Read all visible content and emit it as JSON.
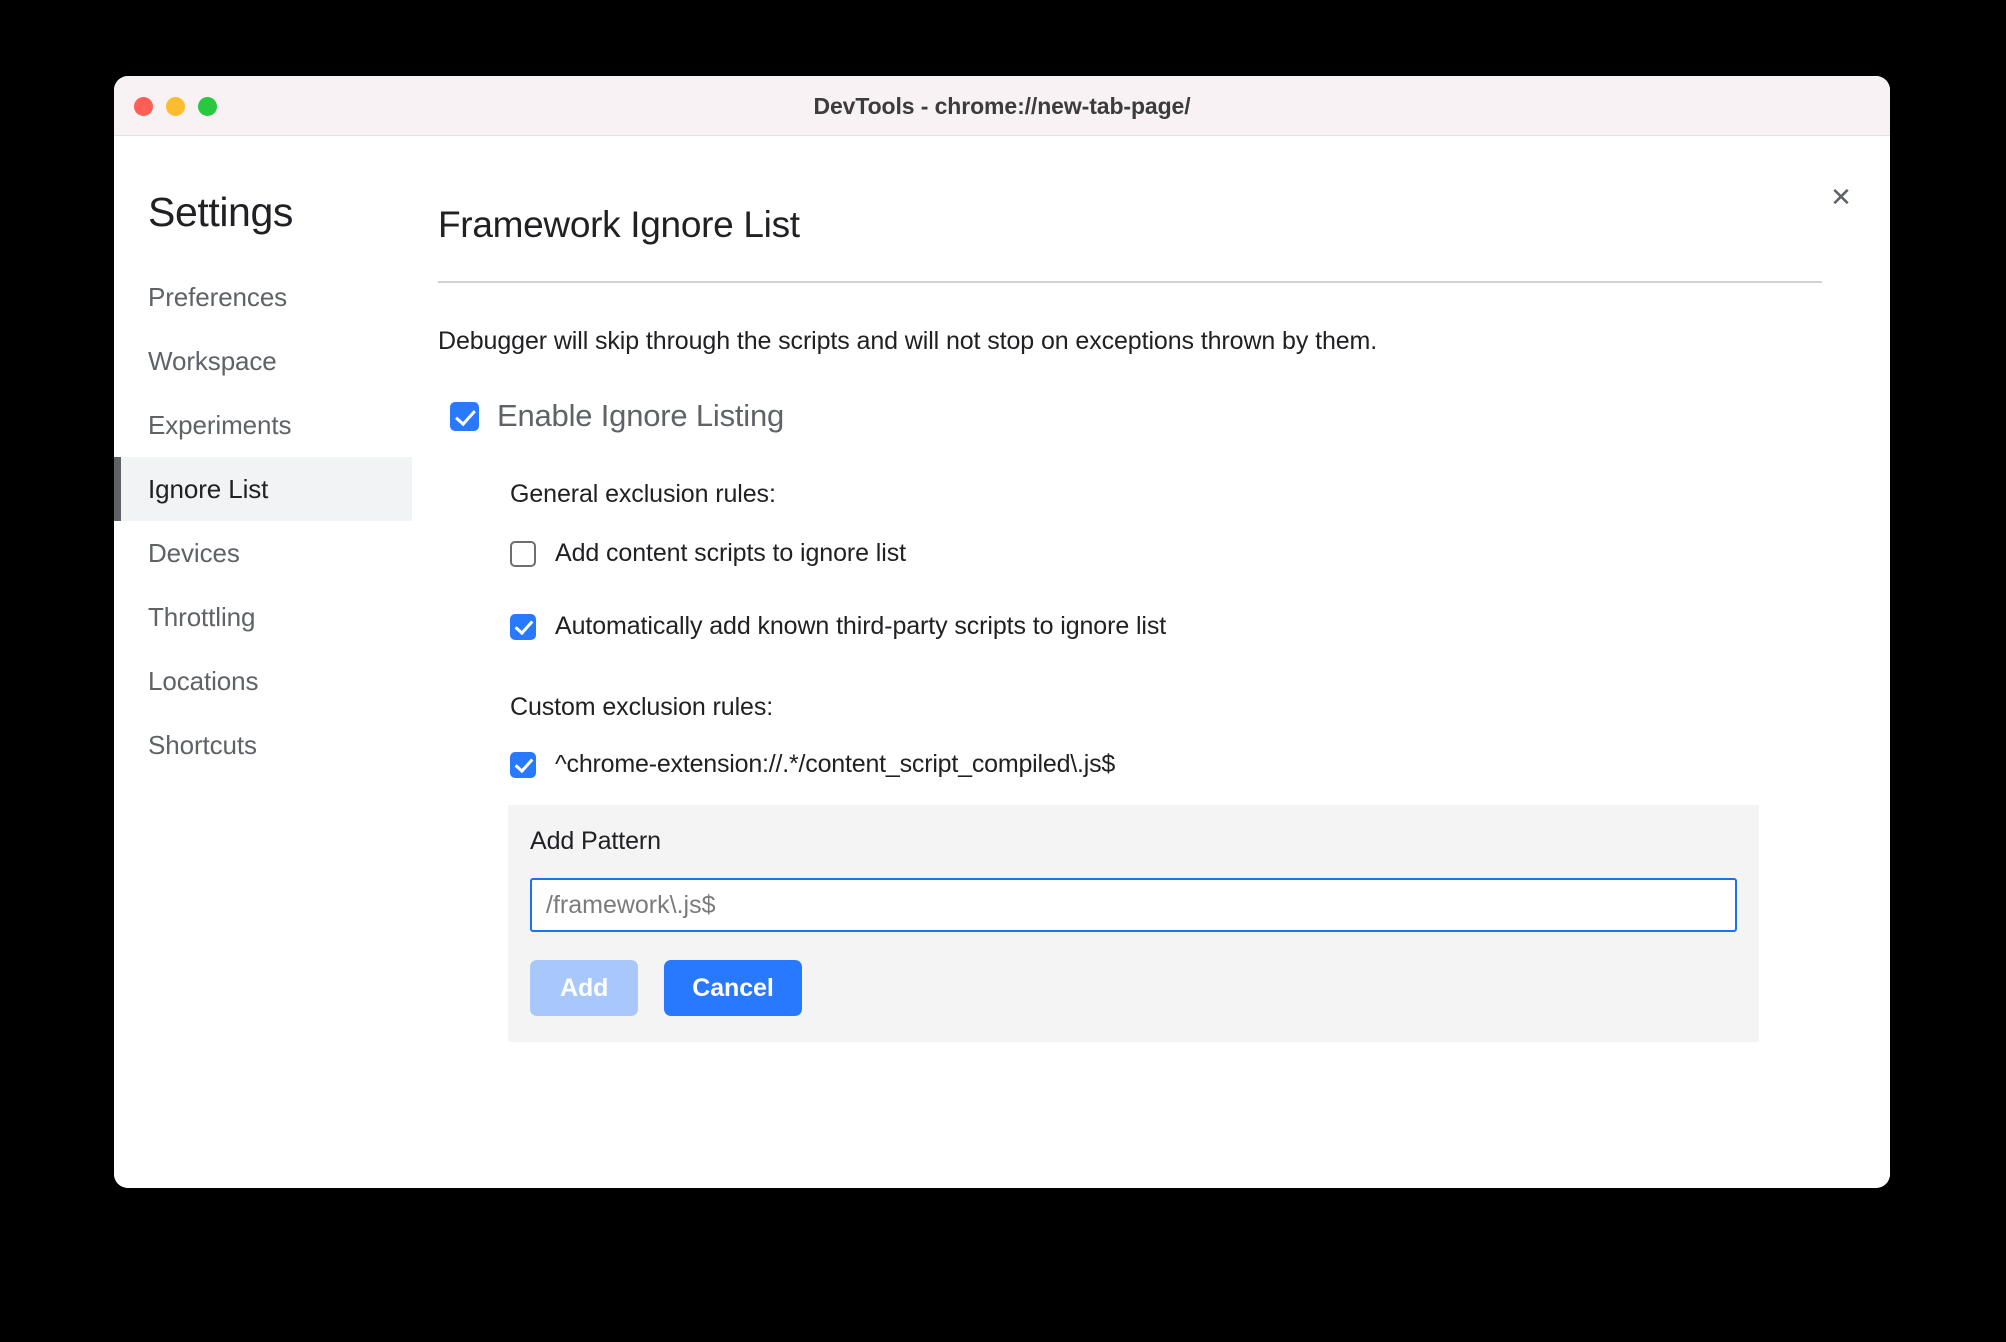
{
  "window": {
    "title": "DevTools - chrome://new-tab-page/",
    "traffic_lights": [
      "close",
      "minimize",
      "maximize"
    ]
  },
  "sidebar": {
    "heading": "Settings",
    "items": [
      {
        "label": "Preferences",
        "selected": false
      },
      {
        "label": "Workspace",
        "selected": false
      },
      {
        "label": "Experiments",
        "selected": false
      },
      {
        "label": "Ignore List",
        "selected": true
      },
      {
        "label": "Devices",
        "selected": false
      },
      {
        "label": "Throttling",
        "selected": false
      },
      {
        "label": "Locations",
        "selected": false
      },
      {
        "label": "Shortcuts",
        "selected": false
      }
    ]
  },
  "content": {
    "close_label": "✕",
    "title": "Framework Ignore List",
    "description": "Debugger will skip through the scripts and will not stop on exceptions thrown by them.",
    "enable": {
      "label": "Enable Ignore Listing",
      "checked": true
    },
    "general": {
      "heading": "General exclusion rules:",
      "rules": [
        {
          "label": "Add content scripts to ignore list",
          "checked": false
        },
        {
          "label": "Automatically add known third-party scripts to ignore list",
          "checked": true
        }
      ]
    },
    "custom": {
      "heading": "Custom exclusion rules:",
      "rules": [
        {
          "label": "^chrome-extension://.*/content_script_compiled\\.js$",
          "checked": true
        }
      ]
    },
    "add_panel": {
      "label": "Add Pattern",
      "input_value": "",
      "input_placeholder": "/framework\\.js$",
      "add_label": "Add",
      "cancel_label": "Cancel"
    }
  },
  "colors": {
    "accent_blue": "#2979ff",
    "focus_blue": "#1a73e8",
    "disabled_blue": "#a8c7fa",
    "selected_bg": "#f1f3f4",
    "selected_bar": "#5f6368",
    "panel_bg": "#f4f4f4",
    "titlebar_bg": "#f8f2f4",
    "light_red": "#ff5f57",
    "light_yellow": "#febc2e",
    "light_green": "#28c840"
  }
}
